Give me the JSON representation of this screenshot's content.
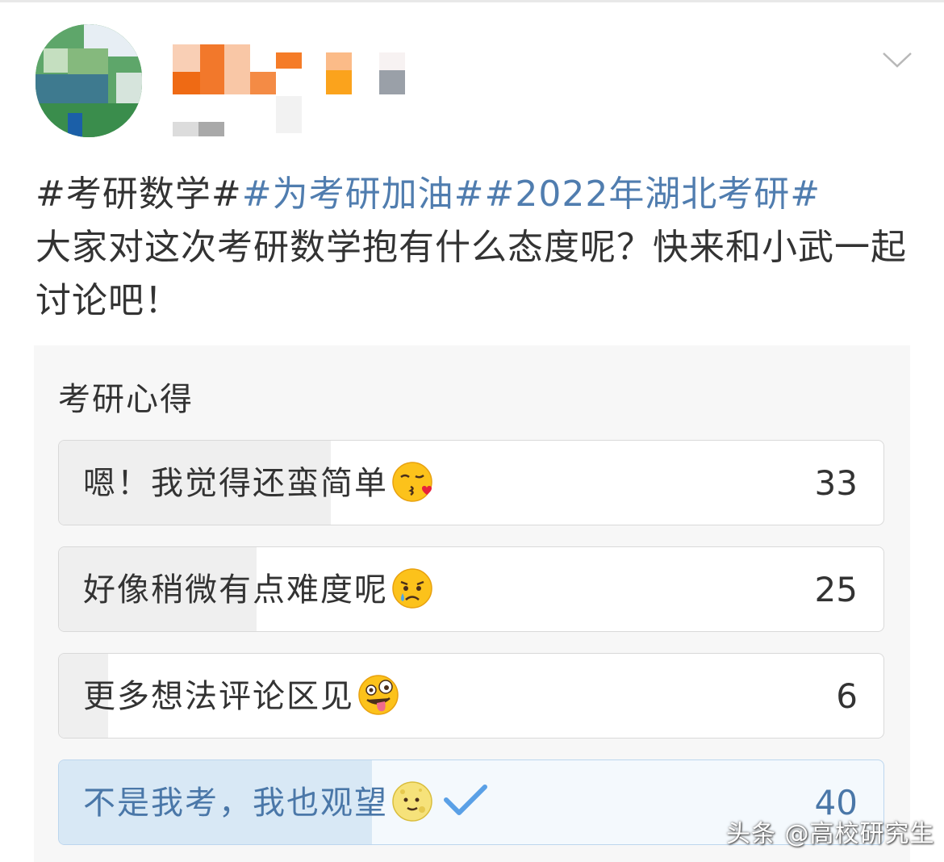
{
  "post": {
    "hashtag_1": "#考研数学#",
    "hashtag_2": "#为考研加油#",
    "hashtag_3": "#2022年湖北考研#",
    "body": "大家对这次考研数学抱有什么态度呢？快来和小武一起讨论吧！"
  },
  "poll": {
    "title": "考研心得",
    "options": [
      {
        "label": "嗯！我觉得还蛮简单",
        "emoji": "kissing-heart-emoji",
        "count": "33",
        "share": 0.33
      },
      {
        "label": "好像稍微有点难度呢",
        "emoji": "crying-face-emoji",
        "count": "25",
        "share": 0.24
      },
      {
        "label": "更多想法评论区见",
        "emoji": "zany-face-emoji",
        "count": "6",
        "share": 0.06
      },
      {
        "label": "不是我考，我也观望",
        "emoji": "moon-face-emoji",
        "count": "40",
        "share": 0.38,
        "selected": true
      }
    ]
  },
  "watermark": "头条 @高校研究生",
  "colors": {
    "link": "#507daf",
    "selected_fill": "#d8e8f5",
    "check": "#5aa0e6"
  },
  "icons": {
    "more": "chevron-down-icon",
    "selected_mark": "checkmark-icon"
  }
}
